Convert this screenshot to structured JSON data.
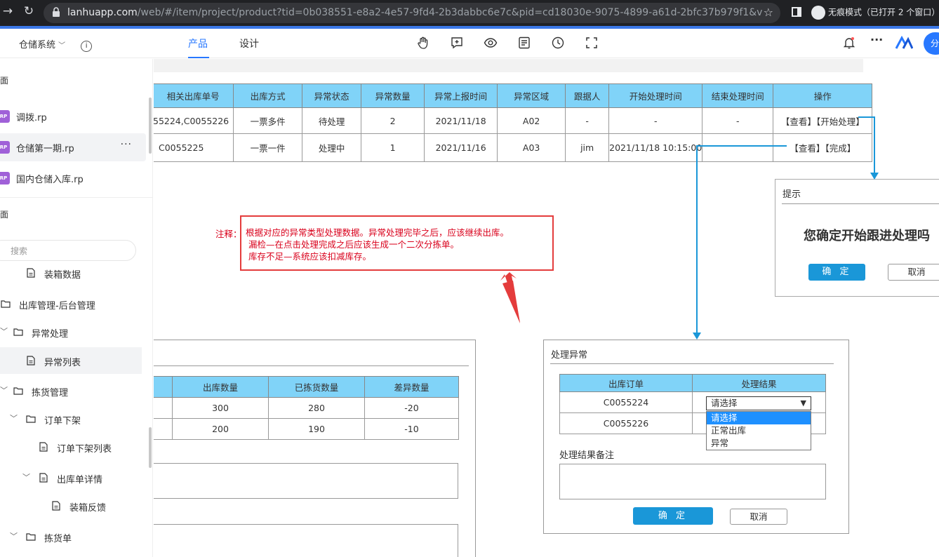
{
  "browser": {
    "url_host": "lanhuapp.com",
    "url_path": "/web/#/item/project/product?tid=0b038551-e8a2-4e57-9fd4-2b3dabbc6e7c&pid=cd18030e-9075-4899-a61d-2bfc37b979f1&ver...",
    "incognito_label": "无痕模式（已打开 2 个窗口）"
  },
  "appbar": {
    "project_name": "仓储系统",
    "tabs": [
      {
        "label": "产品",
        "active": true
      },
      {
        "label": "设计",
        "active": false
      }
    ],
    "toolbar_icons": [
      "hand-icon",
      "comment-icon",
      "eye-icon",
      "notes-icon",
      "history-icon",
      "fullscreen-icon"
    ],
    "right_icons": [
      "bell-icon",
      "more-icon",
      "logo-icon"
    ],
    "share_label": "分"
  },
  "sidebar": {
    "section_top_fragment": "面",
    "rp_files": [
      {
        "badge": "RP",
        "label": "调拨.rp",
        "selected": false
      },
      {
        "badge": "RP",
        "label": "仓储第一期.rp",
        "selected": true,
        "more": "···"
      },
      {
        "badge": "RP",
        "label": "国内仓储入库.rp",
        "selected": false
      }
    ],
    "section_pages_fragment": "面",
    "search_placeholder": "搜索",
    "tree": [
      {
        "label": "装箱数据",
        "type": "page",
        "indent": 1
      },
      {
        "label": "出库管理-后台管理",
        "type": "folder",
        "indent": 0
      },
      {
        "label": "异常处理",
        "type": "folder",
        "indent": 1,
        "expanded": true
      },
      {
        "label": "异常列表",
        "type": "page",
        "indent": 2,
        "selected": true
      },
      {
        "label": "拣货管理",
        "type": "folder",
        "indent": 1,
        "expanded": true
      },
      {
        "label": "订单下架",
        "type": "folder",
        "indent": 2,
        "expanded": true
      },
      {
        "label": "订单下架列表",
        "type": "page",
        "indent": 3
      },
      {
        "label": "出库单详情",
        "type": "page",
        "indent": 3,
        "expanded": true
      },
      {
        "label": "装箱反馈",
        "type": "page",
        "indent": 4
      },
      {
        "label": "拣货单",
        "type": "folder",
        "indent": 2,
        "expanded": true
      }
    ]
  },
  "main_table": {
    "headers": [
      "相关出库单号",
      "出库方式",
      "异常状态",
      "异常数量",
      "异常上报时间",
      "异常区域",
      "跟据人",
      "开始处理时间",
      "结束处理时间",
      "操作"
    ],
    "rows": [
      {
        "cells": [
          "55224,C0055226",
          "一票多件",
          "待处理",
          "2",
          "2021/11/18",
          "A02",
          "-",
          "-",
          "-"
        ],
        "actions": [
          "【查看】",
          "【开始处理】"
        ]
      },
      {
        "cells": [
          "C0055225",
          "一票一件",
          "处理中",
          "1",
          "2021/11/16",
          "A03",
          "jim",
          "2021/11/18 10:15:00",
          ""
        ],
        "actions": [
          "【查看】",
          "【完成】"
        ]
      }
    ]
  },
  "note": {
    "label": "注释：",
    "lines": [
      "根据对应的异常类型处理数据。异常处理完毕之后，应该继续出库。",
      "漏检—在点击处理完成之后应该生成一个二次分拣单。",
      "库存不足—系统应该扣减库存。"
    ]
  },
  "sub_table": {
    "headers": [
      "",
      "出库数量",
      "已拣货数量",
      "差异数量"
    ],
    "rows": [
      [
        "",
        "300",
        "280",
        "-20"
      ],
      [
        "",
        "200",
        "190",
        "-10"
      ]
    ]
  },
  "confirm_dialog": {
    "title": "提示",
    "message": "您确定开始跟进处理吗",
    "ok_label": "确 定",
    "cancel_label": "取消"
  },
  "handle_dialog": {
    "title": "处理异常",
    "headers": [
      "出库订单",
      "处理结果"
    ],
    "orders": [
      "C0055224",
      "C0055226"
    ],
    "select_value": "请选择",
    "options": [
      "请选择",
      "正常出库",
      "异常"
    ],
    "remark_label": "处理结果备注",
    "ok_label": "确 定",
    "cancel_label": "取消"
  },
  "colors": {
    "header_blue": "#80d3f8",
    "note_red": "#d9001b",
    "primary_button": "#1a97d8",
    "arrow_teal": "#1a97d8",
    "accent": "#2878ff"
  }
}
